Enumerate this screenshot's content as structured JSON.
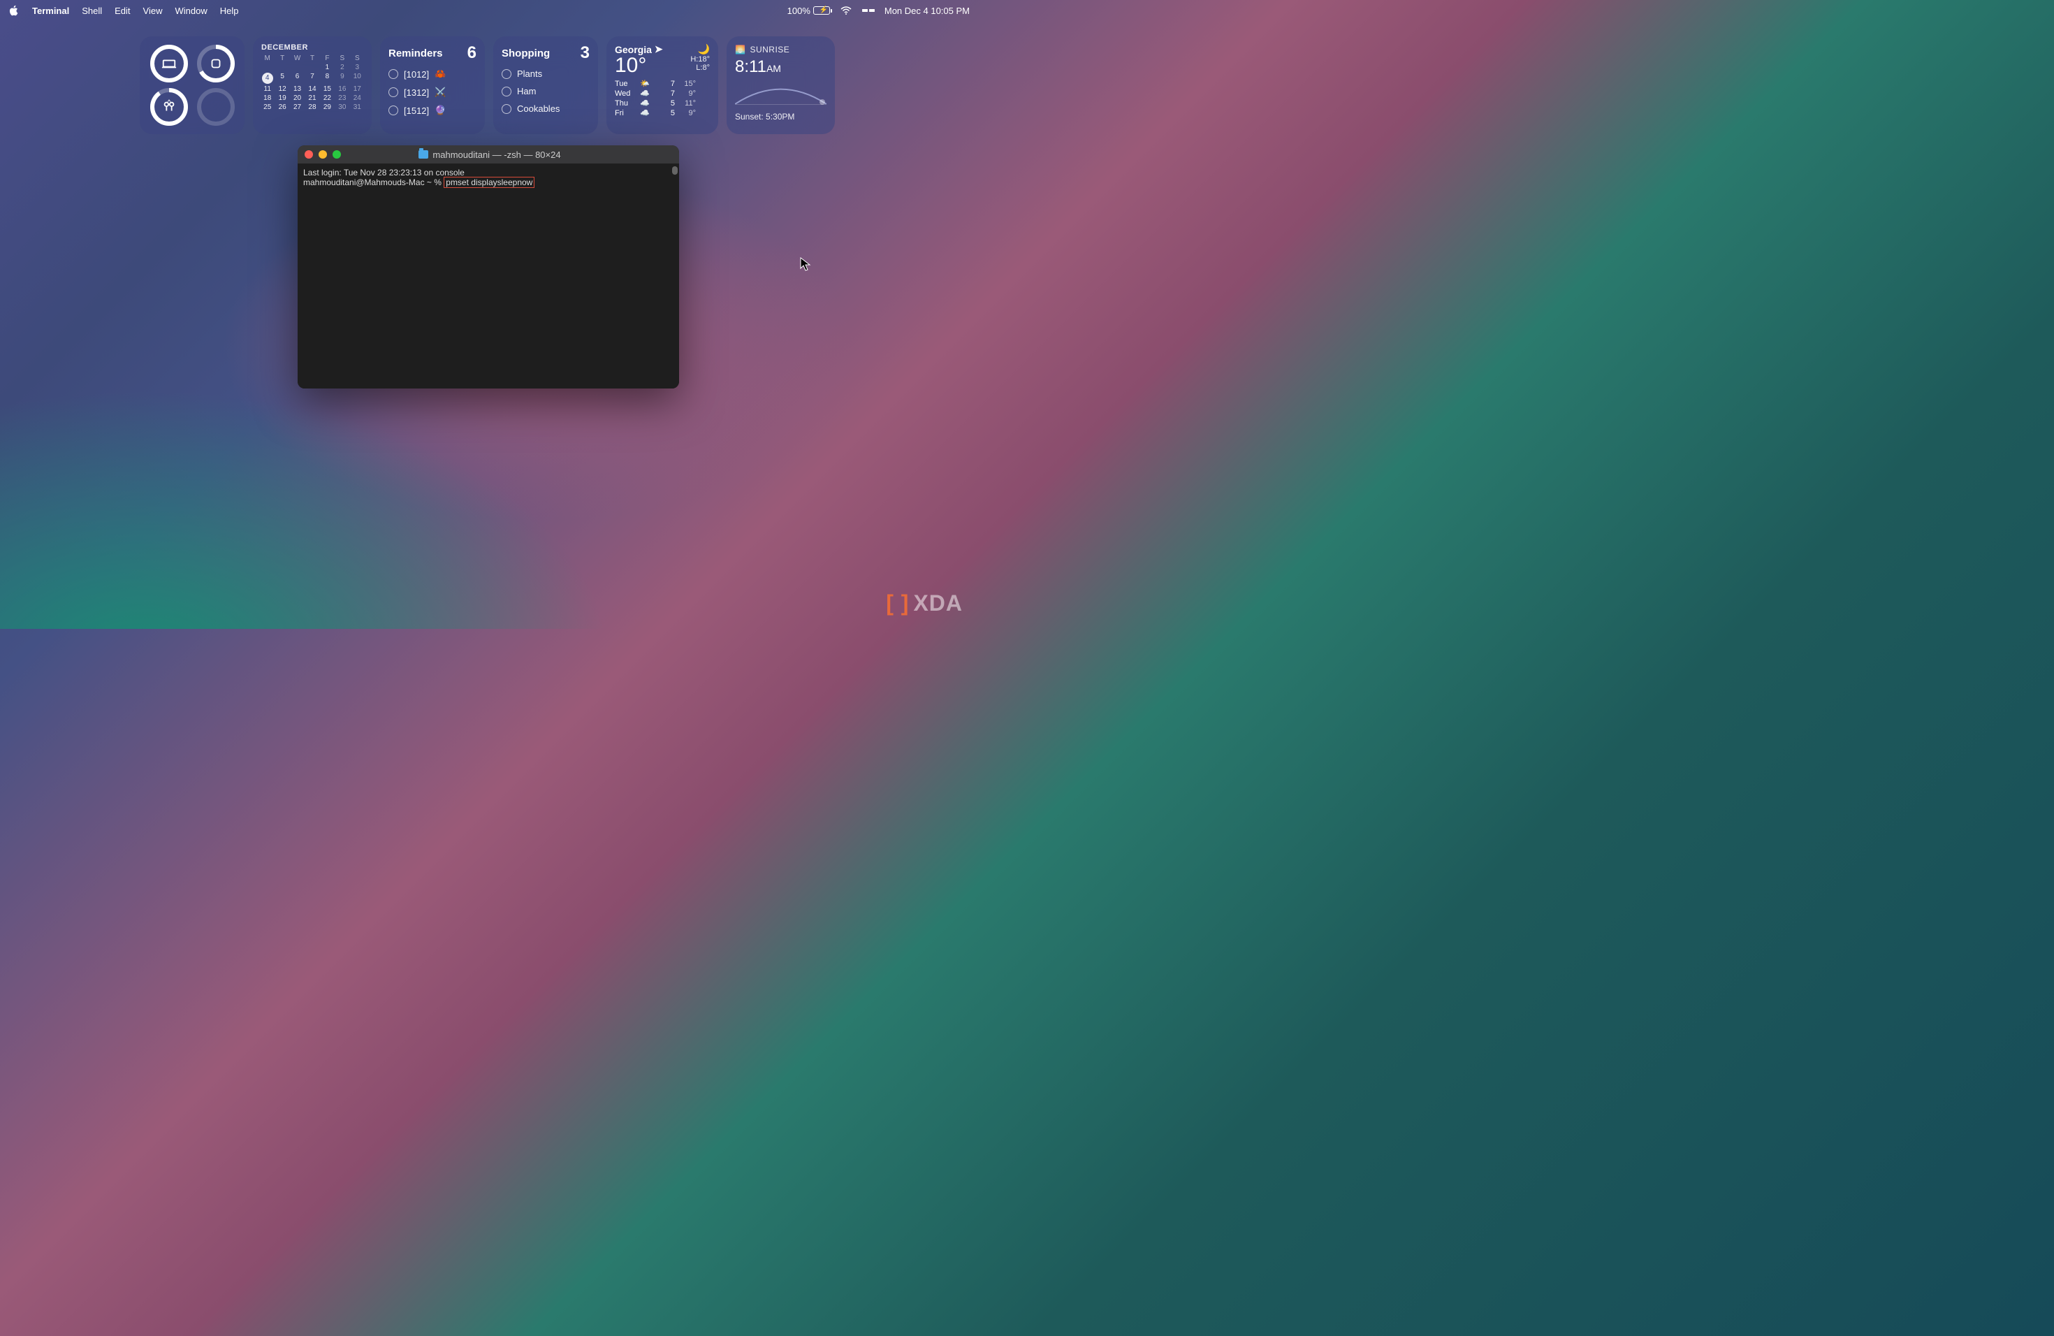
{
  "menubar": {
    "app": "Terminal",
    "items": [
      "Shell",
      "Edit",
      "View",
      "Window",
      "Help"
    ],
    "battery_pct": "100%",
    "clock": "Mon Dec 4  10:05 PM"
  },
  "widgets": {
    "calendar": {
      "month": "DECEMBER",
      "dow": [
        "M",
        "T",
        "W",
        "T",
        "F",
        "S",
        "S"
      ],
      "rows": [
        [
          "",
          "",
          "",
          "",
          "1",
          "2",
          "3"
        ],
        [
          "4",
          "5",
          "6",
          "7",
          "8",
          "9",
          "10"
        ],
        [
          "11",
          "12",
          "13",
          "14",
          "15",
          "16",
          "17"
        ],
        [
          "18",
          "19",
          "20",
          "21",
          "22",
          "23",
          "24"
        ],
        [
          "25",
          "26",
          "27",
          "28",
          "29",
          "30",
          "31"
        ]
      ],
      "today": "4"
    },
    "reminders": {
      "title": "Reminders",
      "count": "6",
      "items": [
        {
          "label": "[1012]",
          "emoji": "🦀"
        },
        {
          "label": "[1312]",
          "emoji": "⚔️"
        },
        {
          "label": "[1512]",
          "emoji": "🔮"
        }
      ]
    },
    "shopping": {
      "title": "Shopping",
      "count": "3",
      "items": [
        {
          "label": "Plants"
        },
        {
          "label": "Ham"
        },
        {
          "label": "Cookables"
        }
      ]
    },
    "weather": {
      "location": "Georgia",
      "temp": "10°",
      "hi": "H:18°",
      "lo": "L:8°",
      "days": [
        {
          "d": "Tue",
          "icon": "🌤️",
          "hi": "7",
          "lo": "15°"
        },
        {
          "d": "Wed",
          "icon": "☁️",
          "hi": "7",
          "lo": "9°"
        },
        {
          "d": "Thu",
          "icon": "☁️",
          "hi": "5",
          "lo": "11°"
        },
        {
          "d": "Fri",
          "icon": "☁️",
          "hi": "5",
          "lo": "9°"
        }
      ]
    },
    "sun": {
      "label": "SUNRISE",
      "time": "8:11",
      "ampm": "AM",
      "sunset": "Sunset: 5:30PM"
    }
  },
  "terminal": {
    "title": "mahmouditani — -zsh — 80×24",
    "line1": "Last login: Tue Nov 28 23:23:13 on console",
    "prompt": "mahmouditani@Mahmouds-Mac ~ % ",
    "command": "pmset displaysleepnow"
  },
  "watermark": "XDA"
}
